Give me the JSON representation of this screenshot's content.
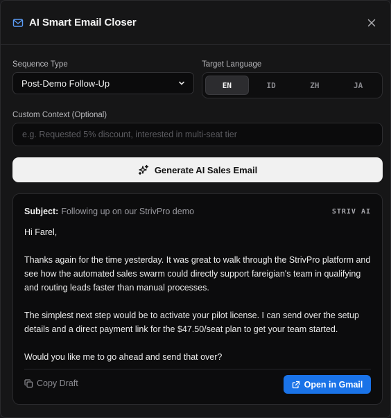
{
  "header": {
    "title": "AI Smart Email Closer",
    "icon": "mail-icon",
    "close_icon": "close-icon"
  },
  "form": {
    "sequence_label": "Sequence Type",
    "sequence_value": "Post-Demo Follow-Up",
    "language_label": "Target Language",
    "languages": [
      "EN",
      "ID",
      "ZH",
      "JA"
    ],
    "language_selected": "EN",
    "context_label": "Custom Context (Optional)",
    "context_placeholder": "e.g. Requested 5% discount, interested in multi-seat tier",
    "context_value": ""
  },
  "generate_button": {
    "label": "Generate AI Sales Email",
    "icon": "sparkles-icon"
  },
  "draft": {
    "subject_key": "Subject:",
    "subject_value": "Following up on our StrivPro demo",
    "brand": "STRIV AI",
    "paragraphs": [
      "Hi Farel,",
      "Thanks again for the time yesterday. It was great to walk through the StrivPro platform and see how the automated sales swarm could directly support fareigian's team in qualifying and routing leads faster than manual processes.",
      "The simplest next step would be to activate your pilot license. I can send over the setup details and a direct payment link for the $47.50/seat plan to get your team started.",
      "Would you like me to go ahead and send that over?"
    ],
    "copy_label": "Copy Draft",
    "gmail_label": "Open in Gmail"
  },
  "colors": {
    "accent": "#1a73e8",
    "background": "#161617"
  }
}
